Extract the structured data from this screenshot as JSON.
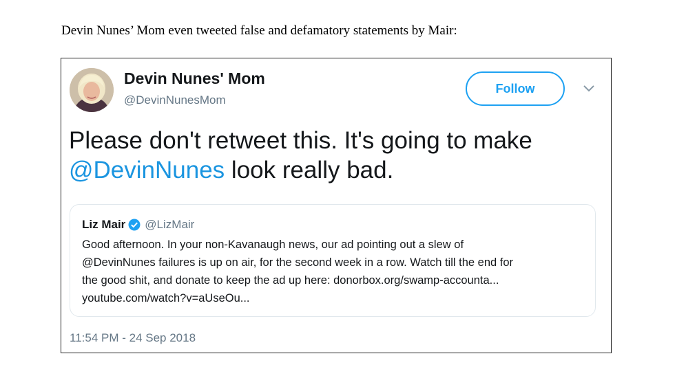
{
  "caption": "Devin Nunes’ Mom even tweeted false and defamatory statements by Mair:",
  "tweet": {
    "display_name": "Devin Nunes' Mom",
    "handle": "@DevinNunesMom",
    "follow_label": "Follow",
    "text_part1": "Please don't retweet this. It's going to make ",
    "text_mention": "@DevinNunes",
    "text_part2": " look really bad.",
    "timestamp": "11:54 PM - 24 Sep 2018"
  },
  "quoted_tweet": {
    "name": "Liz Mair",
    "handle": "@LizMair",
    "lines": [
      "Good afternoon. In your non-Kavanaugh news, our ad pointing out a slew of",
      "@DevinNunes failures is up on air, for the second week in a row. Watch till the end for",
      "the good shit, and donate to keep the ad up here: donorbox.org/swamp-accounta...",
      "youtube.com/watch?v=aUseOu..."
    ]
  },
  "colors": {
    "accent": "#1da1f2",
    "mention": "#1b95e0",
    "secondary_text": "#657786",
    "primary_text": "#14171a"
  },
  "icons": {
    "verified": "verified-badge-icon",
    "menu": "chevron-down-icon"
  }
}
